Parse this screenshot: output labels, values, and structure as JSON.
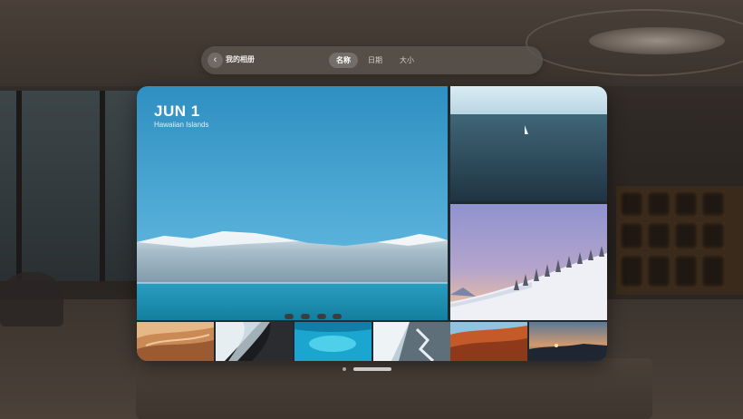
{
  "toolbar": {
    "back_icon": "chevron-left-icon",
    "album_title": "我的相册",
    "tabs": [
      {
        "label": "名称",
        "active": true
      },
      {
        "label": "日期",
        "active": false
      },
      {
        "label": "大小",
        "active": false
      }
    ]
  },
  "gallery": {
    "hero": {
      "date": "JUN 1",
      "location": "Hawaiian Islands"
    }
  },
  "colors": {
    "sky": "#3d9bc7",
    "sea": "#1b93b4",
    "toolbar_bg": "#5c544e"
  }
}
